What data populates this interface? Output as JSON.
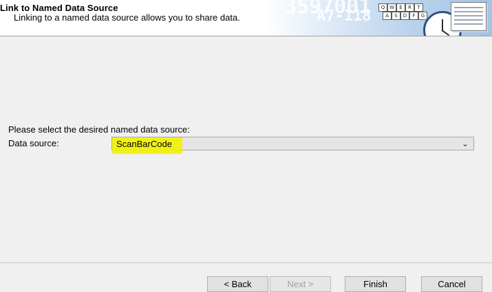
{
  "header": {
    "title": "Link to Named Data Source",
    "subtitle": "Linking to a named data source allows you to share data.",
    "banner_text_1": "3597001",
    "banner_text_2": "A7-118",
    "keyboard_row_1": [
      "Q",
      "W",
      "E",
      "R",
      "T"
    ],
    "keyboard_row_2": [
      "A",
      "S",
      "D",
      "F",
      "G"
    ]
  },
  "body": {
    "prompt": "Please select the desired named data source:",
    "data_source_label": "Data source:",
    "data_source_value": "ScanBarCode"
  },
  "buttons": {
    "back": "< Back",
    "next": "Next >",
    "finish": "Finish",
    "cancel": "Cancel"
  },
  "colors": {
    "highlight": "#f2f200",
    "window_bg": "#f0f0f0"
  }
}
